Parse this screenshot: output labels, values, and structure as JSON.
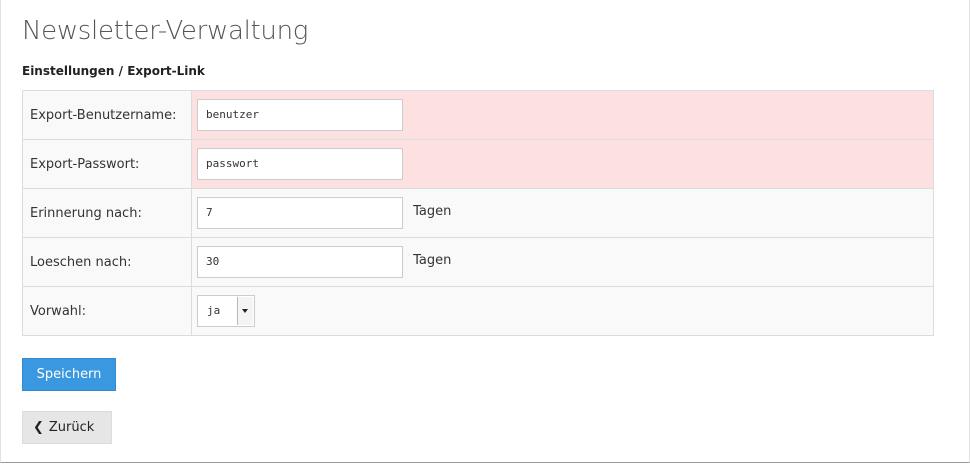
{
  "header": {
    "title": "Newsletter-Verwaltung",
    "section": "Einstellungen / Export-Link"
  },
  "form": {
    "rows": [
      {
        "label": "Export-Benutzername:",
        "value": "benutzer",
        "state": "error"
      },
      {
        "label": "Export-Passwort:",
        "value": "passwort",
        "state": "error"
      },
      {
        "label": "Erinnerung nach:",
        "value": "7",
        "unit": "Tagen"
      },
      {
        "label": "Loeschen nach:",
        "value": "30",
        "unit": "Tagen"
      },
      {
        "label": "Vorwahl:",
        "value": "ja",
        "type": "select"
      }
    ]
  },
  "actions": {
    "save_label": "Speichern",
    "back_label": "Zurück",
    "back_icon": "chevron-left-icon"
  },
  "colors": {
    "error_row": "#fde0e0",
    "primary_button": "#3a98e0",
    "secondary_button": "#e6e6e6"
  }
}
